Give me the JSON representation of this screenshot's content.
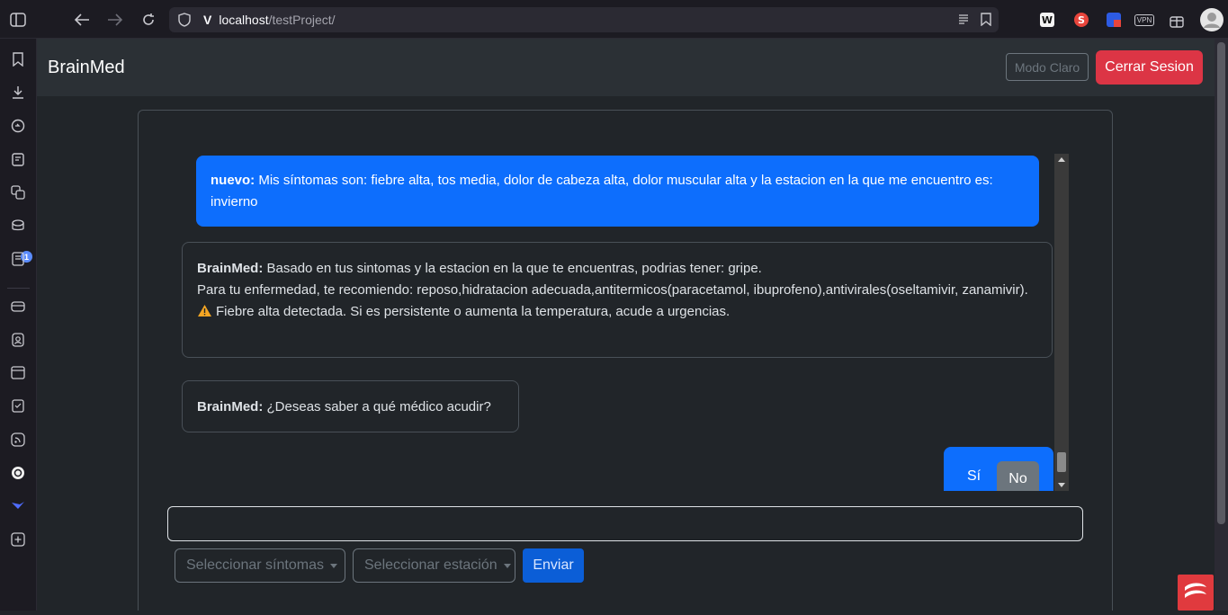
{
  "browser": {
    "url_host": "localhost",
    "url_path": "/testProject/",
    "vpn_label": "VPN",
    "side_badge": "1"
  },
  "navbar": {
    "brand": "BrainMed",
    "mode_button": "Modo Claro",
    "logout_button": "Cerrar Sesion"
  },
  "chat": {
    "user_message": {
      "author": "nuevo:",
      "text": " Mis síntomas son: fiebre alta, tos media, dolor de cabeza alta, dolor muscular alta y la estacion en la que me encuentro es: invierno"
    },
    "bot_message_1": {
      "author": "BrainMed:",
      "line1": " Basado en tus sintomas y la estacion en la que te encuentras, podrias tener: gripe.",
      "line2": "Para tu enfermedad, te recomiendo: reposo,hidratacion adecuada,antitermicos(paracetamol, ibuprofeno),antivirales(oseltamivir, zanamivir).",
      "warning": "Fiebre alta detectada. Si es persistente o aumenta la temperatura, acude a urgencias."
    },
    "bot_message_2": {
      "author": "BrainMed:",
      "text": " ¿Deseas saber a qué médico acudir?"
    },
    "choices": {
      "yes": "Sí",
      "no": "No"
    }
  },
  "controls": {
    "message_value": "",
    "symptoms_dropdown": "Seleccionar síntomas",
    "season_dropdown": "Seleccionar estación",
    "send_button": "Enviar"
  }
}
